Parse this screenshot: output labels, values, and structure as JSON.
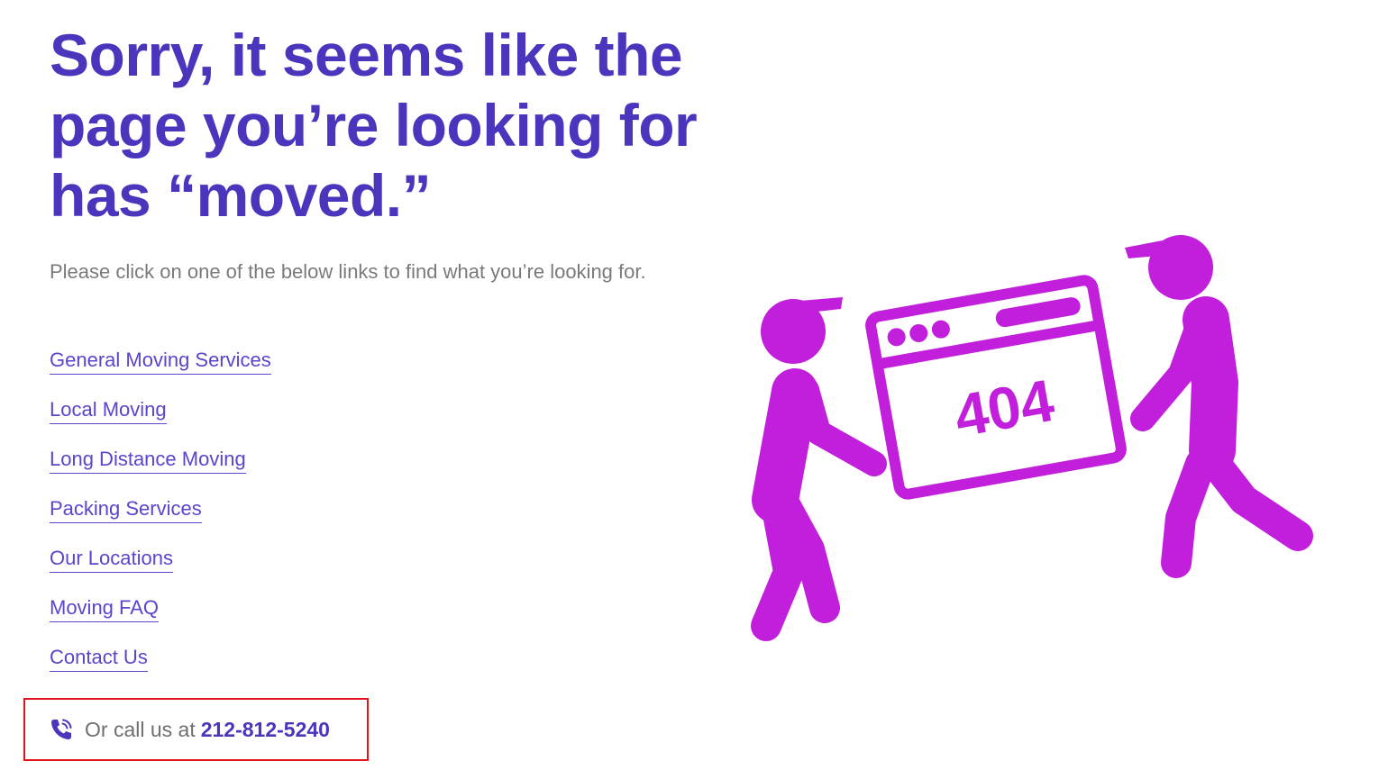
{
  "headline": {
    "line1": "Sorry, it seems like the",
    "line2": "page you’re looking for",
    "line3": "has “moved.”"
  },
  "subtext": "Please click on one of the below links to find what you’re looking for.",
  "links": [
    {
      "label": "General Moving Services"
    },
    {
      "label": "Local Moving"
    },
    {
      "label": "Long Distance Moving"
    },
    {
      "label": "Packing Services"
    },
    {
      "label": "Our Locations"
    },
    {
      "label": "Moving FAQ"
    },
    {
      "label": "Contact Us"
    }
  ],
  "call": {
    "prefix": "Or call us at",
    "number": "212-812-5240",
    "icon": "phone-icon"
  },
  "illustration": {
    "error_code": "404",
    "icon": "movers-carrying-404-window-illustration"
  },
  "colors": {
    "heading": "#4a35bd",
    "link": "#5a45cc",
    "body_text": "#7a7a7a",
    "illustration": "#c21fdc",
    "highlight_border": "#e0141d"
  }
}
